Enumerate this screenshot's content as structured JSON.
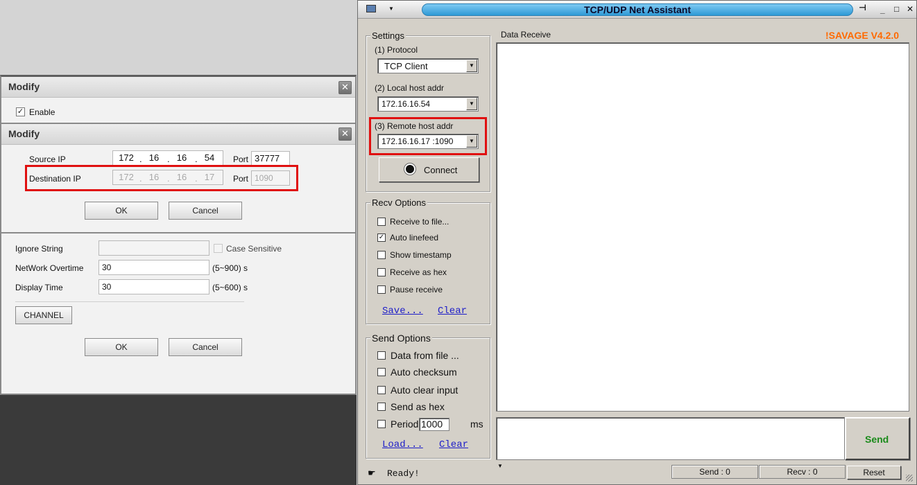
{
  "modify": {
    "title_outer": "Modify",
    "enable_label": "Enable",
    "enable_checked": true,
    "title_inner": "Modify",
    "source_ip_label": "Source IP",
    "source_ip": [
      "172",
      "16",
      "16",
      "54"
    ],
    "source_port_label": "Port",
    "source_port": "37777",
    "dest_ip_label": "Destination IP",
    "dest_ip": [
      "172",
      "16",
      "16",
      "17"
    ],
    "dest_port_label": "Port",
    "dest_port": "1090",
    "ok_label": "OK",
    "cancel_label": "Cancel",
    "ignore_string_label": "Ignore String",
    "ignore_string_value": "",
    "case_sensitive_label": "Case Sensitive",
    "network_overtime_label": "NetWork Overtime",
    "network_overtime_value": "30",
    "network_overtime_range": "(5~900) s",
    "display_time_label": "Display Time",
    "display_time_value": "30",
    "display_time_range": "(5~600) s",
    "channel_label": "CHANNEL",
    "ok2_label": "OK",
    "cancel2_label": "Cancel"
  },
  "net": {
    "title": "TCP/UDP Net Assistant",
    "version": "!SAVAGE V4.2.0",
    "settings": {
      "title": "Settings",
      "protocol_label": "(1) Protocol",
      "protocol_value": "TCP Client",
      "local_label": "(2) Local host addr",
      "local_value": "172.16.16.54",
      "remote_label": "(3) Remote host addr",
      "remote_value": "172.16.16.17 :1090",
      "connect_label": "Connect"
    },
    "recv_options": {
      "title": "Recv Options",
      "items": [
        {
          "label": "Receive to file...",
          "checked": false
        },
        {
          "label": "Auto linefeed",
          "checked": true
        },
        {
          "label": "Show timestamp",
          "checked": false
        },
        {
          "label": "Receive as hex",
          "checked": false
        },
        {
          "label": "Pause receive",
          "checked": false
        }
      ],
      "save_link": "Save...",
      "clear_link": "Clear"
    },
    "send_options": {
      "title": "Send Options",
      "items": [
        {
          "label": "Data from file ...",
          "checked": false
        },
        {
          "label": "Auto checksum",
          "checked": false
        },
        {
          "label": "Auto clear input",
          "checked": false
        },
        {
          "label": "Send as hex",
          "checked": false
        },
        {
          "label": "Period",
          "checked": false
        }
      ],
      "period_value": "1000",
      "period_unit": "ms",
      "load_link": "Load...",
      "clear_link": "Clear"
    },
    "data_receive_label": "Data Receive",
    "send_button": "Send",
    "status": {
      "ready": "Ready!",
      "send_count": "Send : 0",
      "recv_count": "Recv : 0",
      "reset_label": "Reset"
    },
    "colors": {
      "version": "#ff6a00",
      "send_button": "#1a8a1a",
      "title_pill": "#3aa6e0",
      "highlight": "#e01010"
    }
  }
}
